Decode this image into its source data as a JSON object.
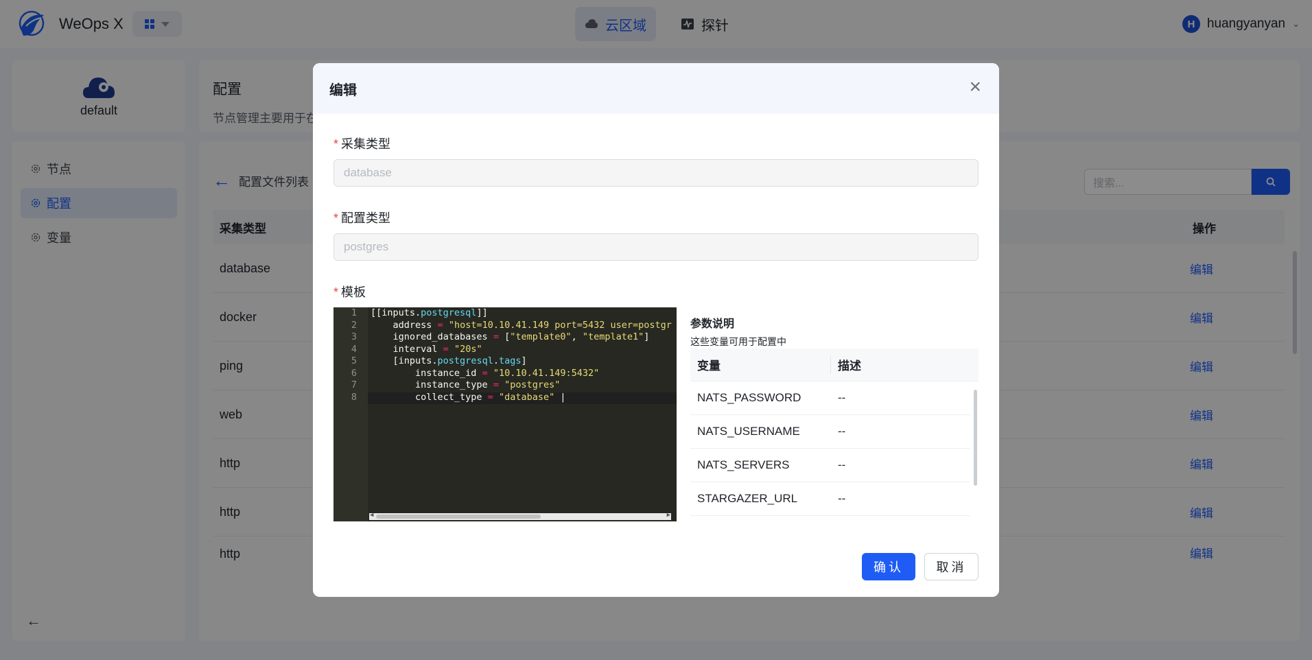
{
  "app": {
    "title": "WeOps X"
  },
  "topnav": {
    "tabs": [
      {
        "label": "云区域",
        "icon": "cloud-icon",
        "active": true
      },
      {
        "label": "探针",
        "icon": "probe-icon",
        "active": false
      }
    ]
  },
  "user": {
    "initial": "H",
    "name": "huangyanyan"
  },
  "sidebar": {
    "region": "default",
    "items": [
      {
        "label": "节点",
        "active": false
      },
      {
        "label": "配置",
        "active": true
      },
      {
        "label": "变量",
        "active": false
      }
    ]
  },
  "main": {
    "title": "配置",
    "description": "节点管理主要用于在",
    "back_label": "配置文件列表",
    "search_placeholder": "搜索...",
    "table": {
      "headers": [
        "采集类型",
        "操作"
      ],
      "rows": [
        {
          "type": "database",
          "action": "编辑"
        },
        {
          "type": "docker",
          "action": "编辑"
        },
        {
          "type": "ping",
          "action": "编辑"
        },
        {
          "type": "web",
          "action": "编辑"
        },
        {
          "type": "http",
          "action": "编辑"
        },
        {
          "type": "http",
          "action": "编辑"
        },
        {
          "type": "http",
          "action": "编辑"
        }
      ]
    }
  },
  "modal": {
    "title": "编辑",
    "fields": {
      "collect_type": {
        "label": "采集类型",
        "value": "database"
      },
      "config_type": {
        "label": "配置类型",
        "value": "postgres"
      },
      "template": {
        "label": "模板"
      }
    },
    "editor": {
      "line_numbers": [
        "1",
        "2",
        "3",
        "4",
        "5",
        "6",
        "7",
        "8"
      ]
    },
    "params": {
      "title": "参数说明",
      "subtitle": "这些变量可用于配置中",
      "headers": [
        "变量",
        "描述"
      ],
      "rows": [
        {
          "name": "NATS_PASSWORD",
          "desc": "--"
        },
        {
          "name": "NATS_USERNAME",
          "desc": "--"
        },
        {
          "name": "NATS_SERVERS",
          "desc": "--"
        },
        {
          "name": "STARGAZER_URL",
          "desc": "--"
        }
      ]
    },
    "buttons": {
      "ok": "确认",
      "cancel": "取消"
    }
  },
  "colors": {
    "accent": "#1e5cf5",
    "required": "#e5484d"
  }
}
